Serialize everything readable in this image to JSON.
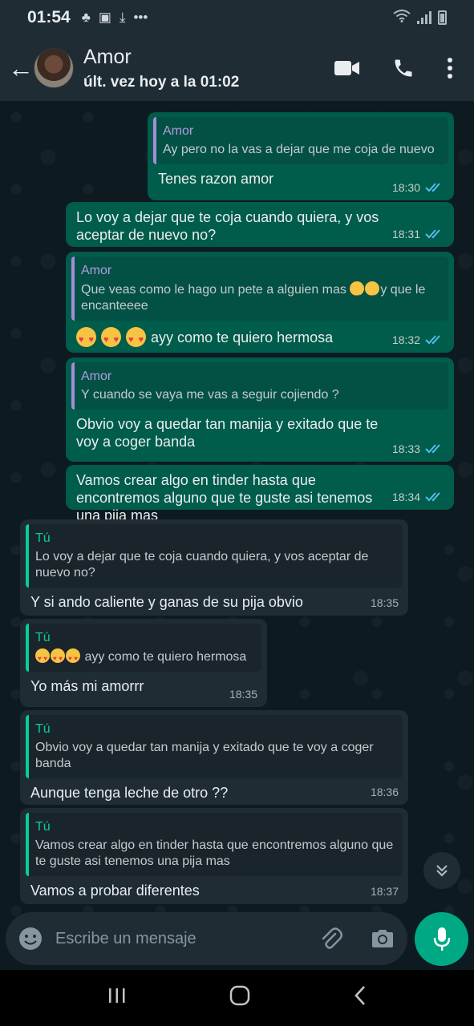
{
  "status_bar": {
    "time": "01:54"
  },
  "header": {
    "contact_name": "Amor",
    "last_seen": "últ. vez hoy a la 01:02"
  },
  "messages": [
    {
      "direction": "out",
      "quote_author": "Amor",
      "quote_text": "Ay pero no la vas a dejar que me coja de nuevo",
      "text": "Tenes razon amor",
      "time": "18:30",
      "status": "read"
    },
    {
      "direction": "out",
      "text": "Lo voy a dejar que te coja cuando quiera, y vos aceptar de nuevo no?",
      "time": "18:31",
      "status": "read"
    },
    {
      "direction": "out",
      "quote_author": "Amor",
      "quote_text_a": "Que veas como le hago un pete a alguien  mas",
      "quote_text_b": "y que le encanteeee",
      "text": "ayy como te quiero hermosa",
      "time": "18:32",
      "status": "read"
    },
    {
      "direction": "out",
      "quote_author": "Amor",
      "quote_text": "Y cuando se vaya me vas a seguir cojiendo ?",
      "text": "Obvio voy a quedar tan manija y exitado que te voy a coger banda",
      "time": "18:33",
      "status": "read"
    },
    {
      "direction": "out",
      "text": "Vamos crear algo en tinder hasta que encontremos alguno que te guste asi tenemos una pija mas",
      "time": "18:34",
      "status": "read"
    },
    {
      "direction": "in",
      "quote_author": "Tú",
      "quote_text": "Lo voy a dejar que te coja cuando quiera, y vos aceptar de nuevo no?",
      "text": "Y si ando caliente y ganas de su pija obvio",
      "time": "18:35"
    },
    {
      "direction": "in",
      "quote_author": "Tú",
      "quote_text": "ayy como te quiero hermosa",
      "text": "Yo más mi amorrr",
      "time": "18:35"
    },
    {
      "direction": "in",
      "quote_author": "Tú",
      "quote_text": "Obvio voy a quedar tan manija y exitado que te voy a coger banda",
      "text": "Aunque tenga leche de otro ??",
      "time": "18:36"
    },
    {
      "direction": "in",
      "quote_author": "Tú",
      "quote_text": "Vamos crear algo en tinder hasta que encontremos alguno que te guste asi tenemos una pija mas",
      "text": "Vamos a probar diferentes",
      "time": "18:37"
    }
  ],
  "composer": {
    "placeholder": "Escribe un mensaje"
  },
  "colors": {
    "accent": "#00a884",
    "outgoing_bubble": "#005c4b",
    "incoming_bubble": "#1f2c34",
    "read_ticks": "#53bdeb"
  },
  "icons": [
    "back-arrow",
    "video-call",
    "phone",
    "more-vert",
    "emoji",
    "attach",
    "camera",
    "mic",
    "chevron-double-down"
  ]
}
